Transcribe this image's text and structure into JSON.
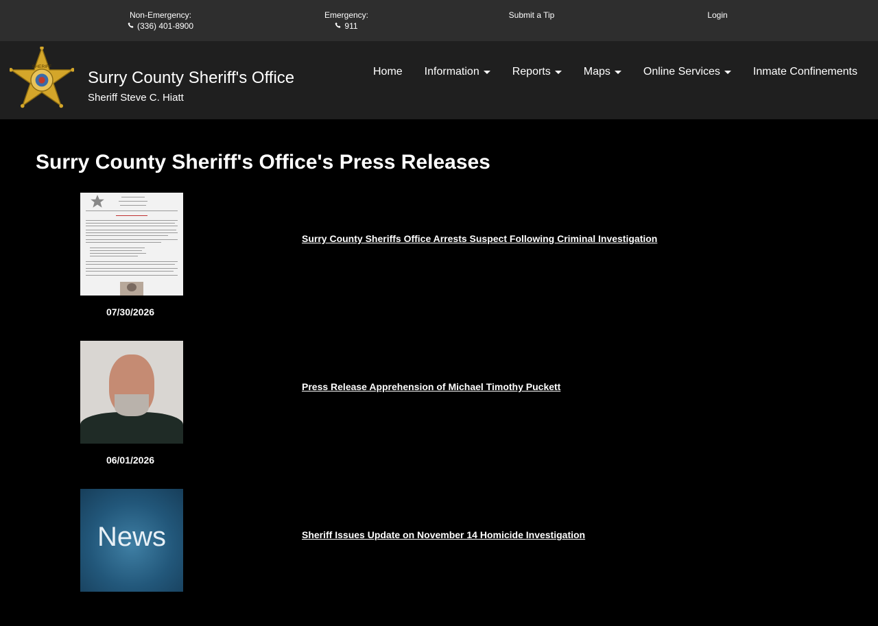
{
  "topbar": {
    "non_emergency_label": "Non-Emergency:",
    "non_emergency_phone": "(336) 401-8900",
    "emergency_label": "Emergency:",
    "emergency_phone": "911",
    "submit_tip": "Submit a Tip",
    "login": "Login"
  },
  "header": {
    "title": "Surry County Sheriff's Office",
    "subtitle": "Sheriff Steve C. Hiatt",
    "logo_text": "SHERIFF"
  },
  "nav": {
    "items": [
      {
        "label": "Home",
        "dropdown": false
      },
      {
        "label": "Information",
        "dropdown": true
      },
      {
        "label": "Reports",
        "dropdown": true
      },
      {
        "label": "Maps",
        "dropdown": true
      },
      {
        "label": "Online Services",
        "dropdown": true
      },
      {
        "label": "Inmate Confinements",
        "dropdown": false
      }
    ]
  },
  "page": {
    "title": "Surry County Sheriff's Office's Press Releases"
  },
  "releases": [
    {
      "date": "07/30/2026",
      "title": "Surry County Sheriffs Office Arrests Suspect Following Criminal Investigation",
      "thumb": "document"
    },
    {
      "date": "06/01/2026",
      "title": "Press Release Apprehension of Michael Timothy Puckett",
      "thumb": "mugshot"
    },
    {
      "date": "",
      "title": "Sheriff Issues Update on November 14 Homicide Investigation",
      "thumb": "news",
      "thumb_text": "News"
    }
  ],
  "colors": {
    "topbar_bg": "#2e2e2e",
    "header_bg": "#1f1f1f",
    "page_bg": "#000000",
    "text": "#ffffff",
    "badge_gold": "#d4a62a"
  }
}
